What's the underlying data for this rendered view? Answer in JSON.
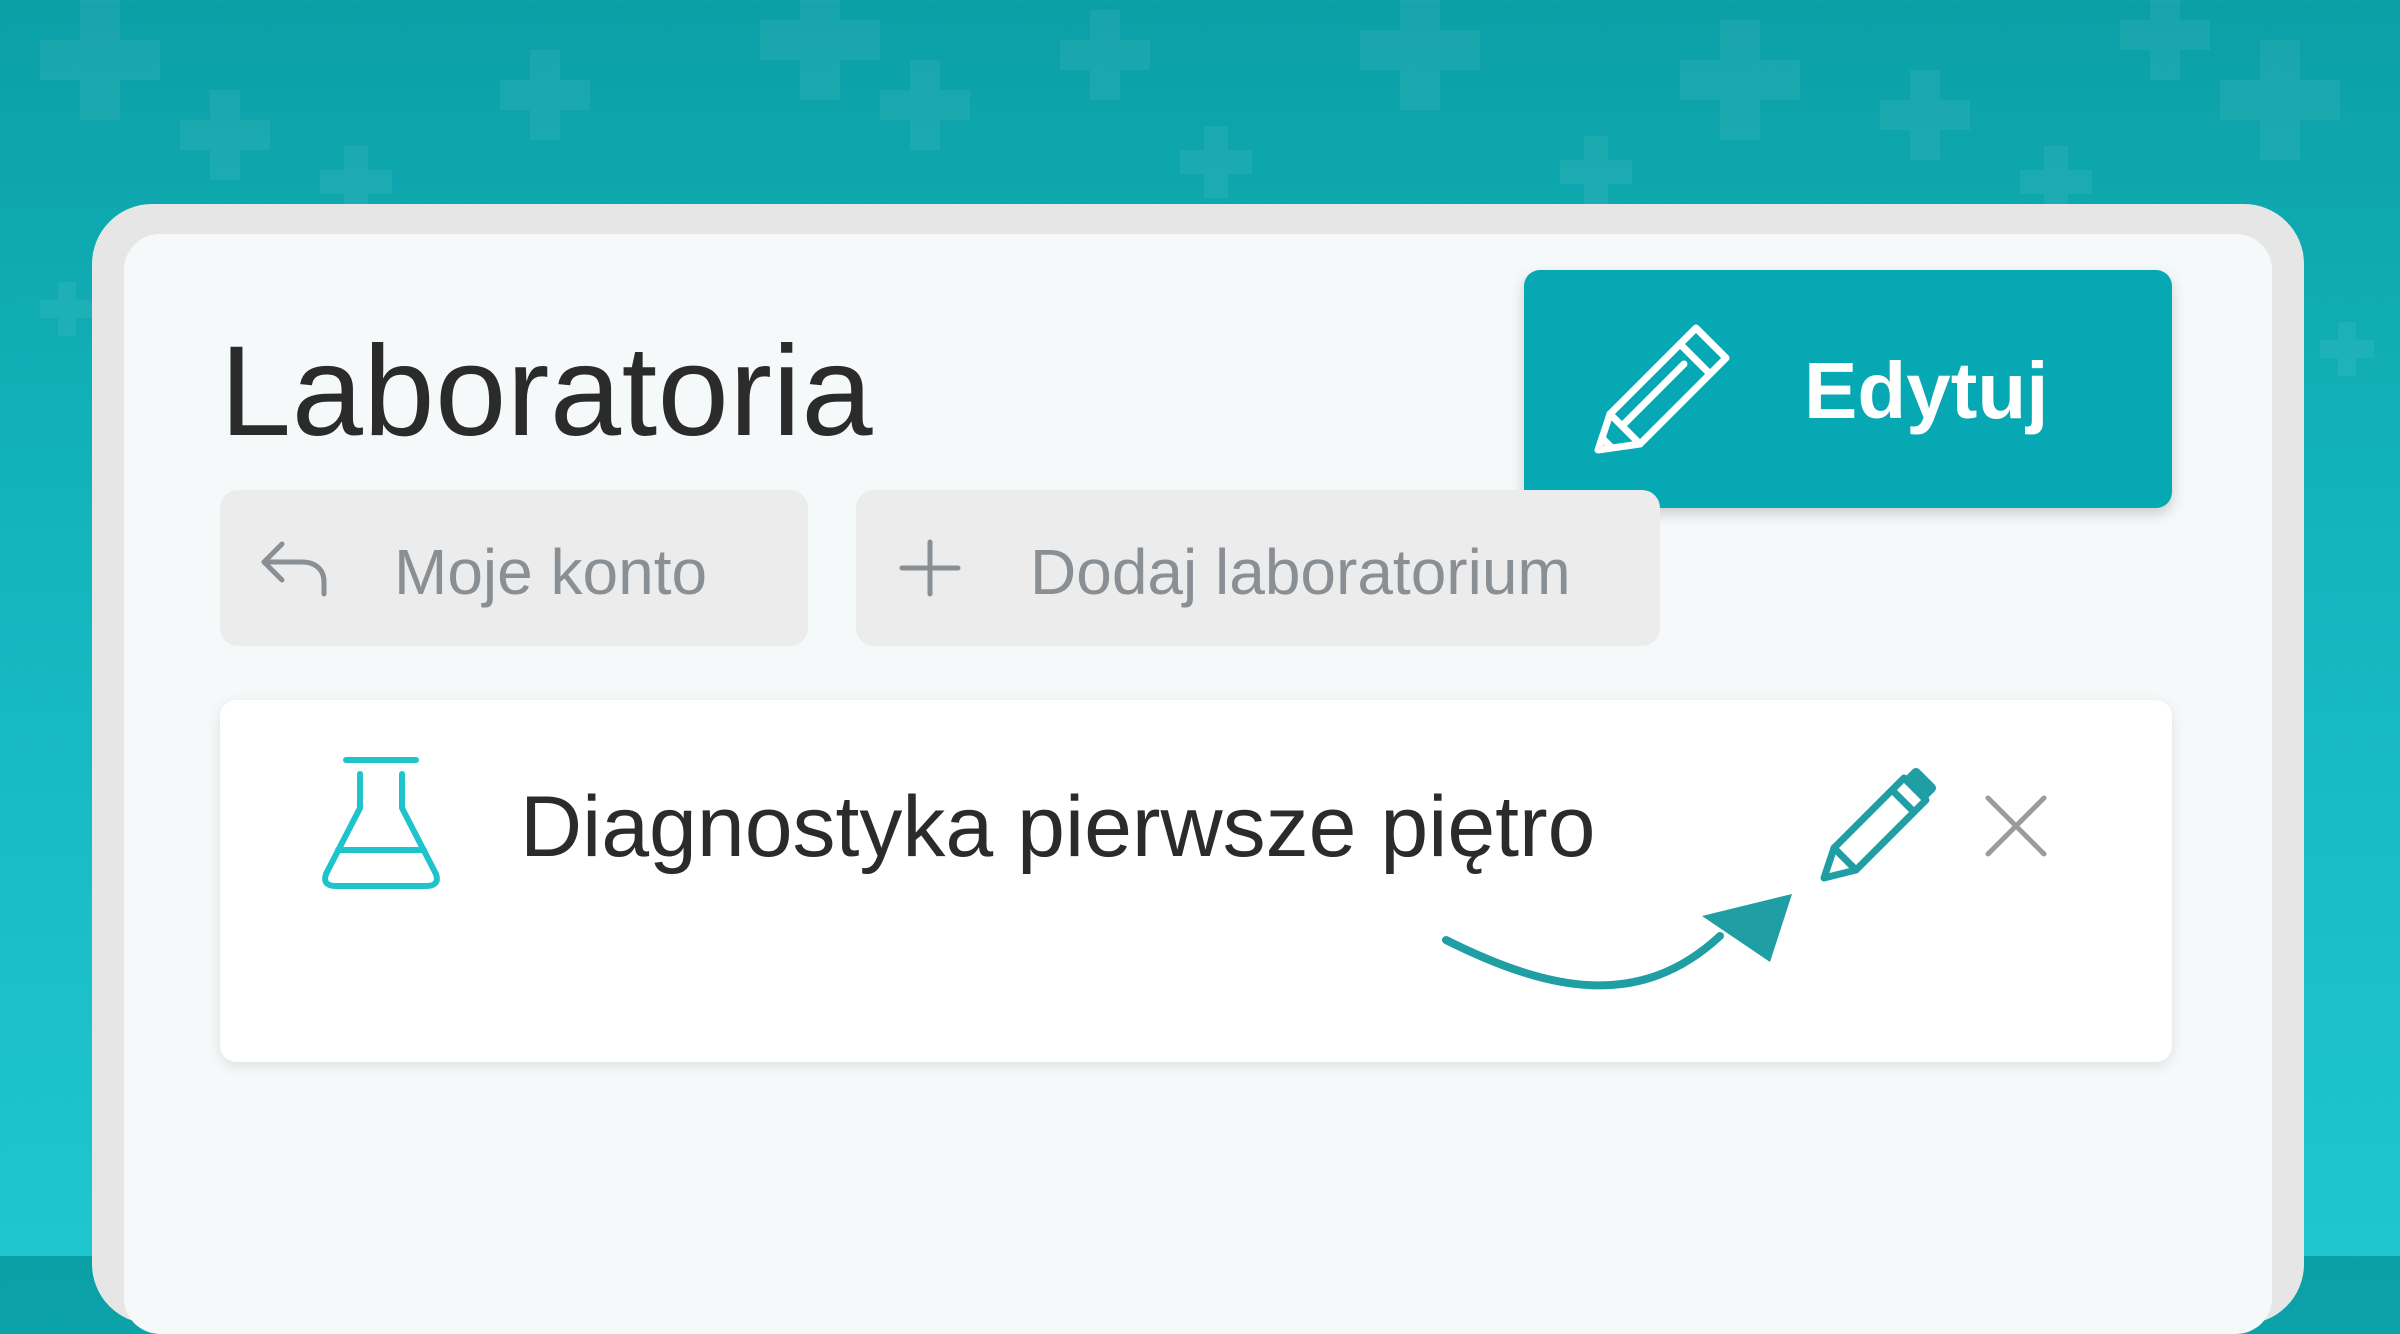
{
  "page": {
    "title": "Laboratoria"
  },
  "toolbar": {
    "edit_label": "Edytuj",
    "back_label": "Moje konto",
    "add_label": "Dodaj laboratorium"
  },
  "labs": [
    {
      "name": "Diagnostyka pierwsze piętro",
      "icon": "flask-icon"
    }
  ],
  "colors": {
    "accent": "#06a8b3",
    "background_top": "#0b9fa6",
    "background_bottom": "#1fc6cf",
    "card": "#ffffff",
    "pill": "#ececec",
    "muted_text": "#8a8f94",
    "text": "#2b2b2b",
    "flask": "#1ec3cc",
    "annotation_arrow": "#1f9ea3"
  },
  "icons": {
    "edit": "pencil-icon",
    "back": "reply-arrow-icon",
    "add": "plus-icon",
    "close": "close-icon"
  }
}
